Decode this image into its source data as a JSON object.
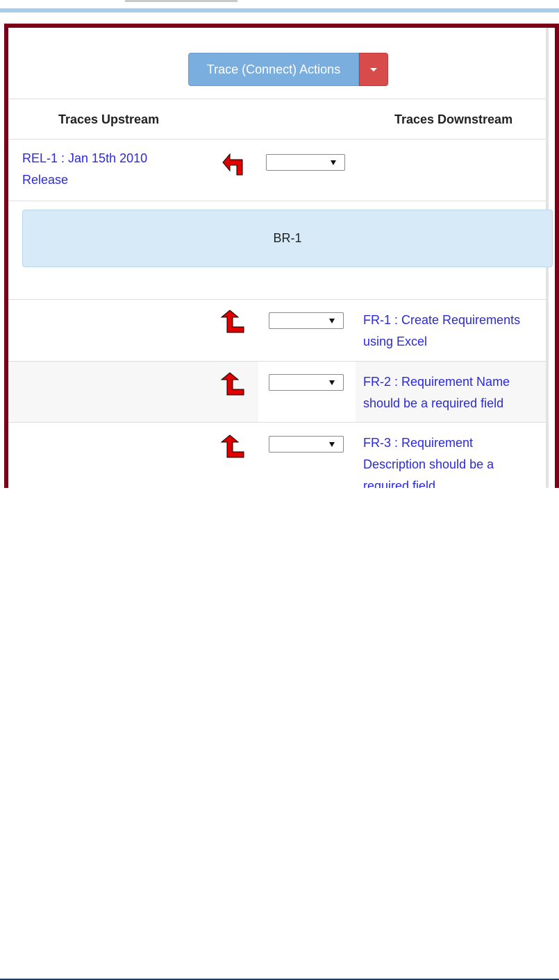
{
  "toolbar": {
    "actions_label": "Trace (Connect) Actions"
  },
  "columns": {
    "upstream": "Traces Upstream",
    "downstream": "Traces Downstream"
  },
  "upstream_item": {
    "line1": "REL-1 : Jan 15th 2010",
    "line2": "Release"
  },
  "current_item": "BR-1",
  "downstream_items": [
    {
      "line1": "FR-1 : Create Requirements",
      "line2": "using Excel"
    },
    {
      "line1": "FR-2 : Requirement Name",
      "line2": "should be a required field"
    },
    {
      "line1": "FR-3 : Requirement",
      "line2": "Description should be a",
      "line3": "required field"
    }
  ],
  "colors": {
    "frame": "#7b0017",
    "button_primary": "#7aaede",
    "button_danger": "#d84b4b",
    "link": "#2a2ad8",
    "highlight": "#d6eaf7",
    "arrow_icon": "#e00000"
  },
  "icons": {
    "upstream_trace": "turn-up-left-arrow-icon",
    "downstream_trace": "turn-up-right-arrow-icon"
  }
}
